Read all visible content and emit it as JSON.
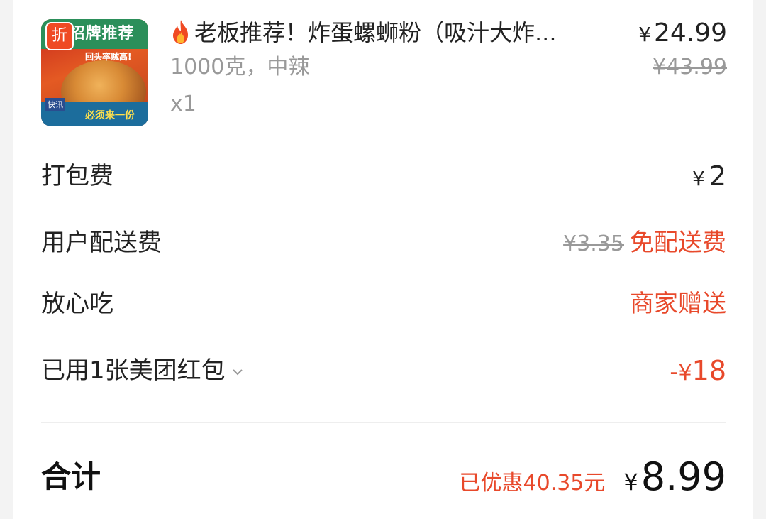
{
  "product": {
    "name": "老板推荐！炸蛋螺蛳粉（吸汁大炸...",
    "spec": "1000克，中辣",
    "quantity": "x1",
    "price_symbol": "¥",
    "price": "24.99",
    "original_price": "¥43.99",
    "thumbnail": {
      "discount_tag": "折",
      "banner_text": "招牌推荐",
      "slogan": "回头率贼高!",
      "quick_text": "快讯",
      "bottom_text": "必须来一份"
    }
  },
  "fees": {
    "packing": {
      "label": "打包费",
      "symbol": "¥",
      "amount": "2"
    },
    "delivery": {
      "label": "用户配送费",
      "original": "¥3.35",
      "free_text": "免配送费"
    },
    "safe_eat": {
      "label": "放心吃",
      "value": "商家赠送"
    },
    "coupon": {
      "label": "已用1张美团红包",
      "prefix": "-",
      "symbol": "¥",
      "amount": "18"
    }
  },
  "total": {
    "label": "合计",
    "saved": "已优惠40.35元",
    "symbol": "¥",
    "amount": "8.99"
  },
  "colors": {
    "accent_red": "#e8492b",
    "muted_gray": "#999999",
    "text_dark": "#222222"
  },
  "icons": {
    "fire": "fire-icon",
    "chevron": "chevron-down-icon"
  }
}
